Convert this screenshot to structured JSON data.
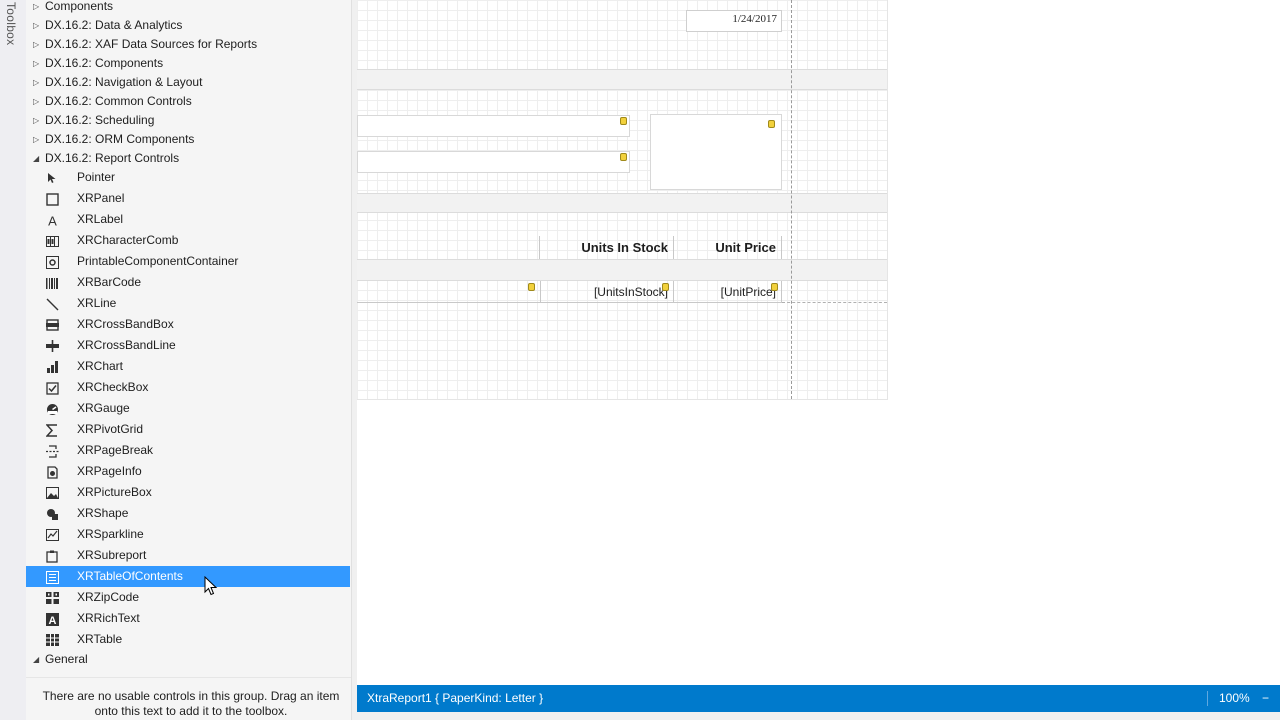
{
  "toolbox": {
    "tab_label": "Toolbox",
    "groups_top": [
      {
        "label": "Components",
        "expanded": false
      },
      {
        "label": "DX.16.2: Data & Analytics",
        "expanded": false
      },
      {
        "label": "DX.16.2: XAF Data Sources for Reports",
        "expanded": false
      },
      {
        "label": "DX.16.2: Components",
        "expanded": false
      },
      {
        "label": "DX.16.2: Navigation & Layout",
        "expanded": false
      },
      {
        "label": "DX.16.2: Common Controls",
        "expanded": false
      },
      {
        "label": "DX.16.2: Scheduling",
        "expanded": false
      },
      {
        "label": "DX.16.2: ORM Components",
        "expanded": false
      },
      {
        "label": "DX.16.2: Report Controls",
        "expanded": true
      }
    ],
    "items": [
      {
        "label": "Pointer",
        "icon": "pointer-icon"
      },
      {
        "label": "XRPanel",
        "icon": "panel-icon"
      },
      {
        "label": "XRLabel",
        "icon": "label-icon"
      },
      {
        "label": "XRCharacterComb",
        "icon": "character-comb-icon"
      },
      {
        "label": "PrintableComponentContainer",
        "icon": "printable-container-icon"
      },
      {
        "label": "XRBarCode",
        "icon": "barcode-icon"
      },
      {
        "label": "XRLine",
        "icon": "line-icon"
      },
      {
        "label": "XRCrossBandBox",
        "icon": "cross-band-box-icon"
      },
      {
        "label": "XRCrossBandLine",
        "icon": "cross-band-line-icon"
      },
      {
        "label": "XRChart",
        "icon": "chart-icon"
      },
      {
        "label": "XRCheckBox",
        "icon": "checkbox-icon"
      },
      {
        "label": "XRGauge",
        "icon": "gauge-icon"
      },
      {
        "label": "XRPivotGrid",
        "icon": "pivot-grid-icon"
      },
      {
        "label": "XRPageBreak",
        "icon": "page-break-icon"
      },
      {
        "label": "XRPageInfo",
        "icon": "page-info-icon"
      },
      {
        "label": "XRPictureBox",
        "icon": "picture-box-icon"
      },
      {
        "label": "XRShape",
        "icon": "shape-icon"
      },
      {
        "label": "XRSparkline",
        "icon": "sparkline-icon"
      },
      {
        "label": "XRSubreport",
        "icon": "subreport-icon"
      },
      {
        "label": "XRTableOfContents",
        "icon": "table-of-contents-icon",
        "selected": true
      },
      {
        "label": "XRZipCode",
        "icon": "zipcode-icon"
      },
      {
        "label": "XRRichText",
        "icon": "rich-text-icon"
      },
      {
        "label": "XRTable",
        "icon": "table-icon"
      }
    ],
    "general_group": {
      "label": "General",
      "expanded": true
    },
    "empty_message": "There are no usable controls in this group. Drag an item onto this text to add it to the toolbox."
  },
  "designer": {
    "date_label": "1/24/2017",
    "headers": {
      "units_in_stock": "Units In Stock",
      "unit_price": "Unit Price"
    },
    "detail": {
      "units_in_stock": "[UnitsInStock]",
      "unit_price": "[UnitPrice]"
    }
  },
  "statusbar": {
    "report_info": "XtraReport1 { PaperKind: Letter }",
    "zoom": "100%",
    "zoom_minus": "−"
  },
  "colors": {
    "selection": "#3399ff",
    "statusbar": "#007acc",
    "smart_tag": "#f2d13c"
  }
}
